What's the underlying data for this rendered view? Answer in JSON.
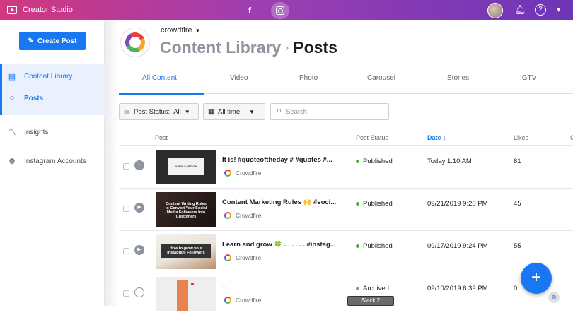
{
  "topbar": {
    "app_title": "Creator Studio",
    "fb_icon": "f"
  },
  "sidebar": {
    "create_post": "Create Post",
    "items": [
      {
        "label": "Content Library",
        "icon": "library-icon"
      },
      {
        "label": "Posts",
        "icon": "dot-icon"
      },
      {
        "label": "Insights",
        "icon": "insights-icon"
      },
      {
        "label": "Instagram Accounts",
        "icon": "accounts-icon"
      }
    ]
  },
  "header": {
    "account": "crowdfire",
    "crumb_parent": "Content Library",
    "crumb_current": "Posts"
  },
  "tabs": [
    "All Content",
    "Video",
    "Photo",
    "Carousel",
    "Stories",
    "IGTV"
  ],
  "filters": {
    "status_label": "Post Status:",
    "status_value": "All",
    "time_value": "All time",
    "search_placeholder": "Search"
  },
  "table": {
    "headers": {
      "post": "Post",
      "status": "Post Status",
      "date": "Date ↓",
      "likes": "Likes",
      "extra": "C"
    },
    "rows": [
      {
        "caption": "It is! #quoteoftheday # #quotes #...",
        "source": "Crowdfire",
        "status": "Published",
        "date": "Today 1:10 AM",
        "likes": "61",
        "thumb_text": "YOUR CAPTION"
      },
      {
        "caption": "Content Marketing Rules 🙌 #soci...",
        "source": "Crowdfire",
        "status": "Published",
        "date": "09/21/2019 9:20 PM",
        "likes": "45",
        "thumb_text": "Content Writing Rules to Convert Your Social Media Followers Into Customers"
      },
      {
        "caption": "Learn and grow 🍀 . . . . . . #instag...",
        "source": "Crowdfire",
        "status": "Published",
        "date": "09/17/2019 9:24 PM",
        "likes": "55",
        "thumb_text": "How to grow your Instagram Followers"
      },
      {
        "caption": "--",
        "source": "Crowdfire",
        "status": "Archived",
        "date": "09/10/2019 6:39 PM",
        "likes": "0",
        "thumb_text": ""
      }
    ]
  },
  "overlay": {
    "slack": "Slack 2",
    "fab": "+"
  }
}
